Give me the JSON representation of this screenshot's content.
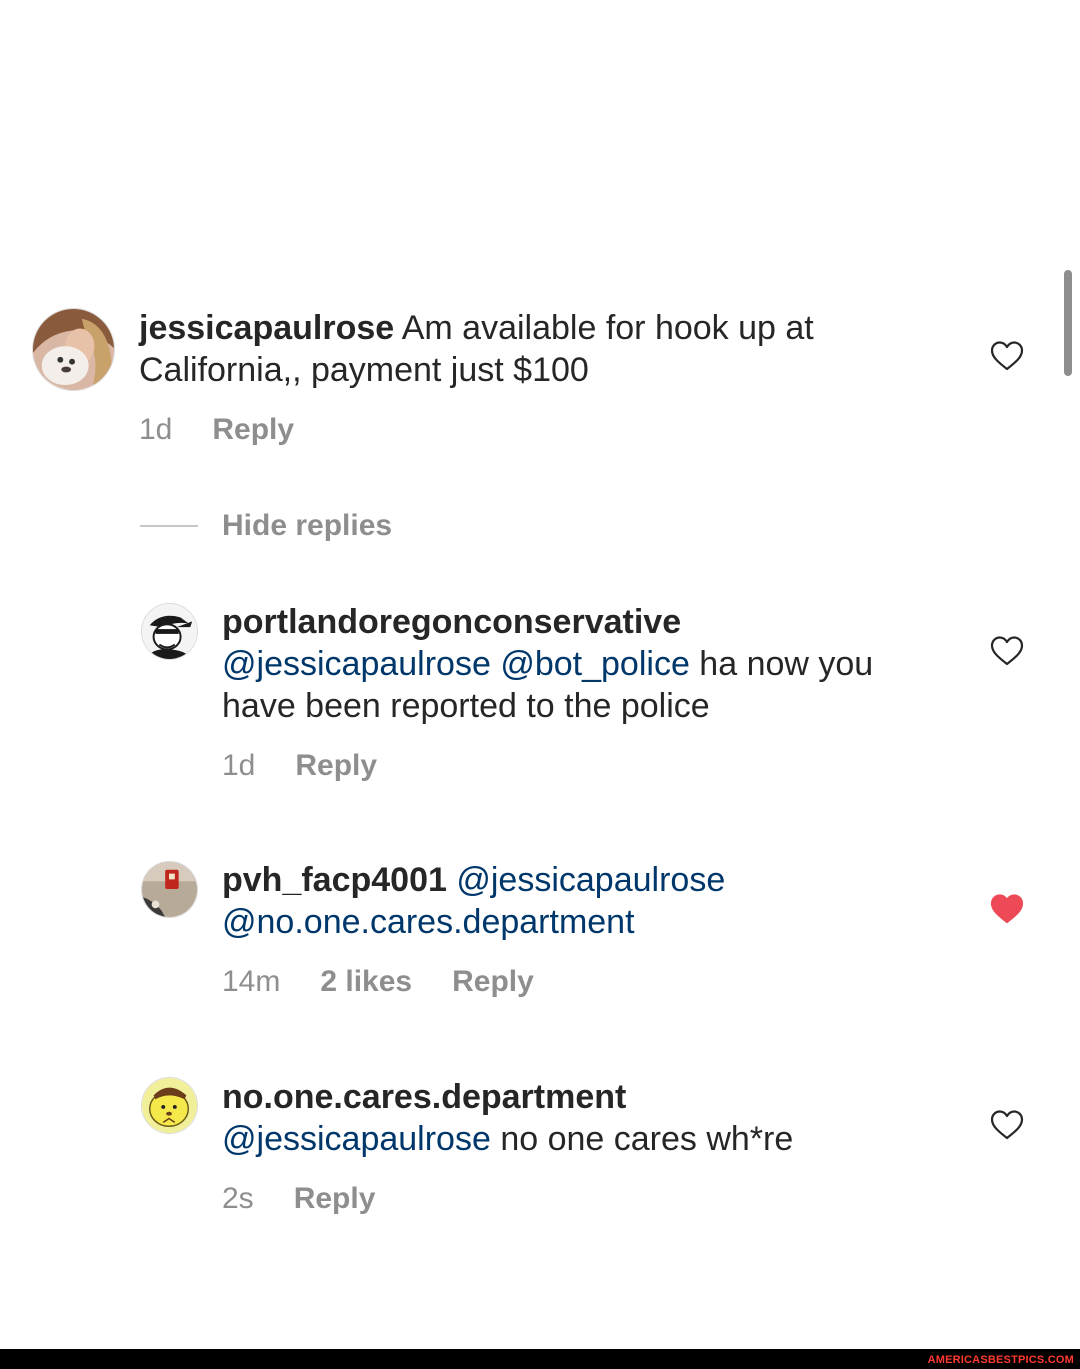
{
  "comments": [
    {
      "username": "jessicapaulrose",
      "text": " Am available for hook up at California,, payment just $100",
      "time": "1d",
      "reply": "Reply",
      "avatar_icon": "profile-photo-woman-with-dog",
      "liked": false
    },
    {
      "username": "portlandoregonconservative",
      "mention1": "@jessicapaulrose",
      "mention2": "@bot_police",
      "text": " ha now you have been reported to the police",
      "time": "1d",
      "reply": "Reply",
      "avatar_icon": "profile-photo-cartoon-man",
      "liked": false
    },
    {
      "username": "pvh_facp4001",
      "mention1": "@jessicapaulrose",
      "mention2": "@no.one.cares.department",
      "time": "14m",
      "likes": "2 likes",
      "reply": "Reply",
      "avatar_icon": "profile-photo-fire-alarm",
      "liked": true
    },
    {
      "username": "no.one.cares.department",
      "mention1": "@jessicapaulrose",
      "text": " no one cares wh*re",
      "time": "2s",
      "reply": "Reply",
      "avatar_icon": "profile-photo-yellow-cartoon",
      "liked": false
    }
  ],
  "hide_replies": "Hide replies",
  "watermark": "AMERICASBESTPICS.COM",
  "colors": {
    "text": "#262626",
    "muted": "#8e8e8e",
    "mention": "#00376b",
    "liked_heart": "#ed4956",
    "footer": "#000000",
    "watermark": "#ff3a2f"
  }
}
